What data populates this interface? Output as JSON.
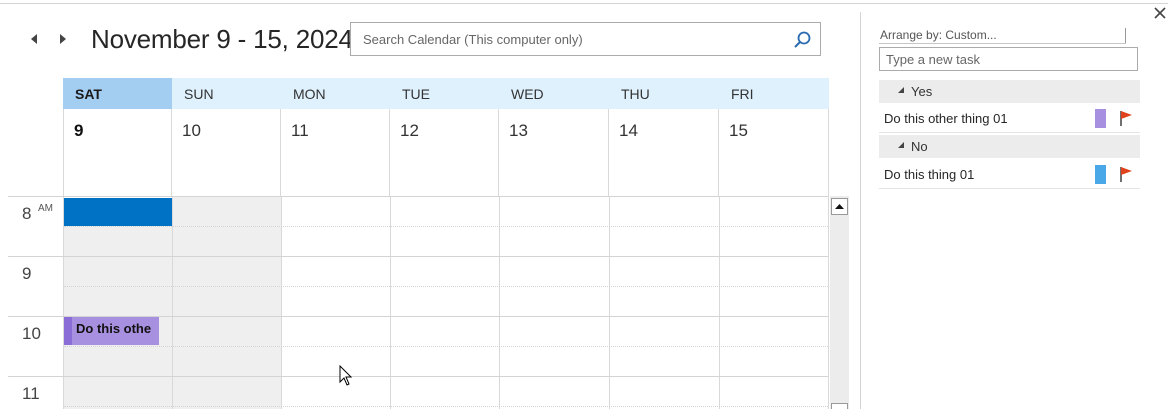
{
  "toolbar": {
    "prev_icon": "triangle-left-icon",
    "next_icon": "triangle-right-icon",
    "date_range": "November 9 - 15, 2024",
    "search_placeholder": "Search Calendar (This computer only)",
    "search_icon": "search-icon"
  },
  "calendar": {
    "days": [
      {
        "name": "SAT",
        "date": "9",
        "selected": true
      },
      {
        "name": "SUN",
        "date": "10",
        "selected": false
      },
      {
        "name": "MON",
        "date": "11",
        "selected": false
      },
      {
        "name": "TUE",
        "date": "12",
        "selected": false
      },
      {
        "name": "WED",
        "date": "13",
        "selected": false
      },
      {
        "name": "THU",
        "date": "14",
        "selected": false
      },
      {
        "name": "FRI",
        "date": "15",
        "selected": false
      }
    ],
    "hours": [
      "8",
      "9",
      "10",
      "11"
    ],
    "first_hour_suffix": "AM",
    "events": [
      {
        "label": "",
        "color": "#0072c6"
      },
      {
        "label": "Do this othe",
        "color": "#a890e0"
      }
    ]
  },
  "tasks_pane": {
    "arrange_label": "Arrange by: Custom...",
    "new_task_placeholder": "Type a new task",
    "groups": [
      {
        "label": "Yes",
        "tasks": [
          {
            "name": "Do this other thing 01",
            "category_color": "#a890e0"
          }
        ]
      },
      {
        "label": "No",
        "tasks": [
          {
            "name": "Do this thing 01",
            "category_color": "#4aa8e8"
          }
        ]
      }
    ],
    "flag_color": "#e0421c"
  },
  "colors": {
    "accent": "#0072c6",
    "header_bg": "#dff1fd",
    "selected_header": "#a4cdf2"
  }
}
